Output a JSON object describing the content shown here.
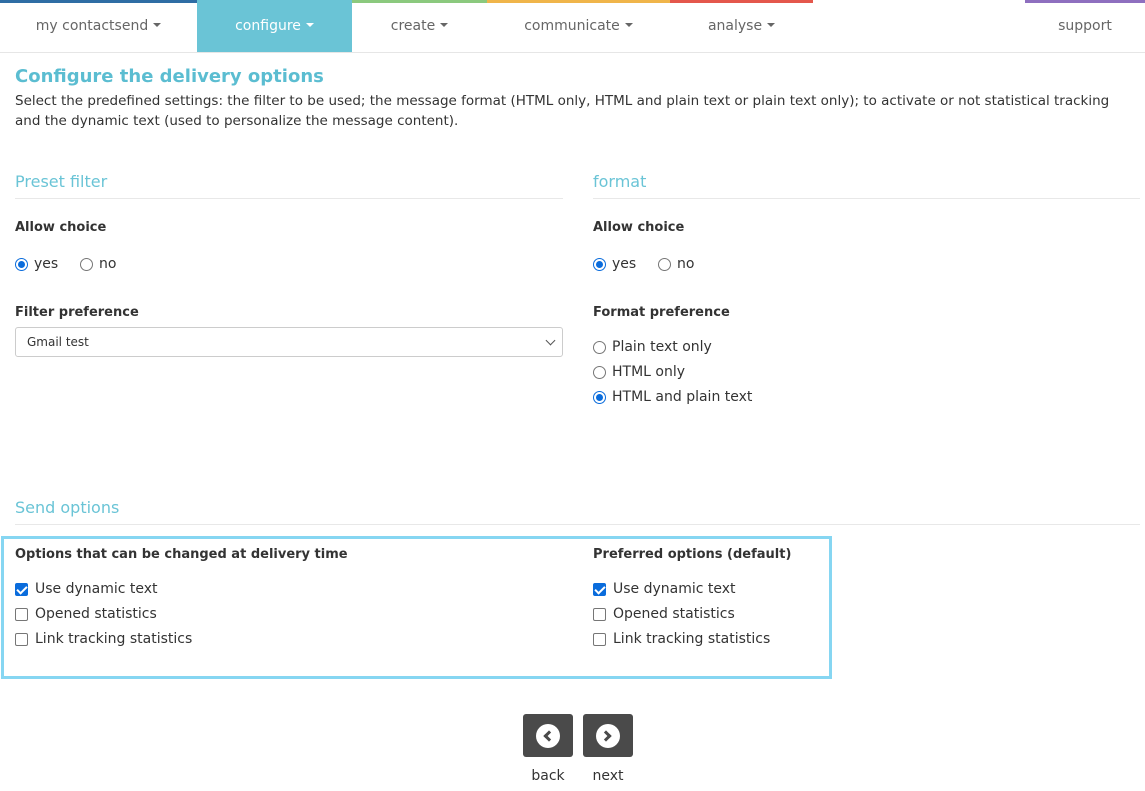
{
  "nav": {
    "items": [
      {
        "label": "my contactsend",
        "color": "#2e6da4",
        "active": false
      },
      {
        "label": "configure",
        "color": "#6ac4d6",
        "active": true
      },
      {
        "label": "create",
        "color": "#8bc97e",
        "active": false
      },
      {
        "label": "communicate",
        "color": "#f0b54a",
        "active": false
      },
      {
        "label": "analyse",
        "color": "#e4574c",
        "active": false
      },
      {
        "label": "support",
        "color": "#8e6fbf",
        "active": false
      }
    ]
  },
  "page": {
    "title": "Configure the delivery options",
    "description": "Select the predefined settings: the filter to be used; the message format (HTML only, HTML and plain text or plain text only); to activate or not statistical tracking and the dynamic text (used to personalize the message content)."
  },
  "preset_filter": {
    "title": "Preset filter",
    "allow_choice_label": "Allow choice",
    "yes_label": "yes",
    "no_label": "no",
    "allow_choice_value": "yes",
    "preference_label": "Filter preference",
    "preference_value": "Gmail test"
  },
  "format": {
    "title": "format",
    "allow_choice_label": "Allow choice",
    "yes_label": "yes",
    "no_label": "no",
    "allow_choice_value": "yes",
    "preference_label": "Format preference",
    "options": [
      "Plain text only",
      "HTML only",
      "HTML and plain text"
    ],
    "selected": "HTML and plain text"
  },
  "send_options": {
    "title": "Send options",
    "changeable": {
      "heading": "Options that can be changed at delivery time",
      "items": [
        {
          "label": "Use dynamic text",
          "checked": true
        },
        {
          "label": "Opened statistics",
          "checked": false
        },
        {
          "label": "Link tracking statistics",
          "checked": false
        }
      ]
    },
    "preferred": {
      "heading": "Preferred options (default)",
      "items": [
        {
          "label": "Use dynamic text",
          "checked": true
        },
        {
          "label": "Opened statistics",
          "checked": false
        },
        {
          "label": "Link tracking statistics",
          "checked": false
        }
      ]
    }
  },
  "buttons": {
    "back_label": "back",
    "next_label": "next"
  },
  "colors": {
    "accent": "#6ac4d6",
    "highlight_border": "#86d6f2",
    "button_bg": "#4a4a4a",
    "control_blue": "#0a6cdc"
  }
}
